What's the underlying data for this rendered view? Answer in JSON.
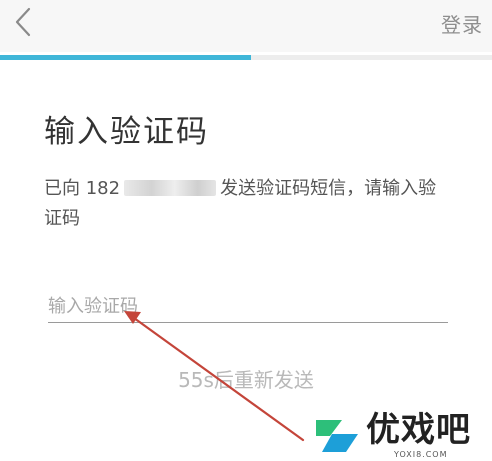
{
  "header": {
    "back_icon": "chevron-left-icon",
    "login_label": "登录"
  },
  "progress": {
    "fraction": 0.51,
    "color": "#3fb6d8"
  },
  "main": {
    "title": "输入验证码",
    "desc_prefix": "已向 182",
    "desc_suffix": "发送验证码短信，请输入验证码",
    "code_input": {
      "placeholder": "输入验证码",
      "value": ""
    },
    "resend_label": "55s后重新发送"
  },
  "annotation": {
    "arrow_color": "#c4453a"
  },
  "watermark": {
    "brand": "优戏吧",
    "domain": "YOXI8.COM",
    "colors": [
      "#2dbf7a",
      "#1d9fd8"
    ]
  }
}
